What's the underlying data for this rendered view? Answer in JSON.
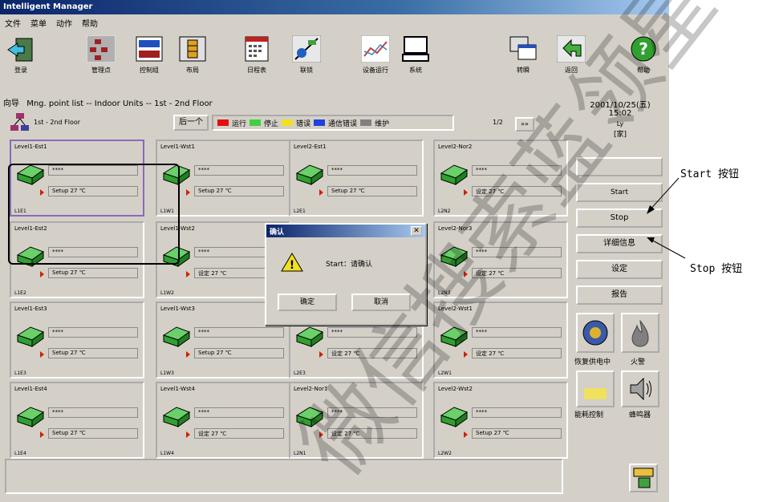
{
  "window": {
    "title": "Intelligent Manager"
  },
  "menu": [
    "文件",
    "菜单",
    "动作",
    "帮助"
  ],
  "toolbar": [
    "登录",
    "管理点",
    "控制组",
    "布局",
    "日程表",
    "联锁",
    "设备运行",
    "系统",
    "转瞬",
    "返回",
    "帮助"
  ],
  "nav": {
    "label": "向导",
    "path": "Mng. point list -- Indoor Units -- 1st - 2nd Floor"
  },
  "floor": {
    "name": "1st - 2nd Floor",
    "prev_label": "后一个",
    "page": "1/2",
    "next_label": "»»"
  },
  "legend": [
    {
      "label": "运行",
      "color": "#e01010"
    },
    {
      "label": "停止",
      "color": "#40d040"
    },
    {
      "label": "错误",
      "color": "#f0e020"
    },
    {
      "label": "通信错误",
      "color": "#2040e0"
    },
    {
      "label": "维护",
      "color": "#808080"
    }
  ],
  "units": [
    {
      "name": "Level1-Est1",
      "setpoint": "Setup 27 ℃",
      "code": "L1E1",
      "value": "****"
    },
    {
      "name": "Level1-Wst1",
      "setpoint": "Setup 27 ℃",
      "code": "L1W1",
      "value": "****"
    },
    {
      "name": "Level2-Est1",
      "setpoint": "Setup 27 ℃",
      "code": "L2E1",
      "value": "****"
    },
    {
      "name": "Level2-Nor2",
      "setpoint": "设定 27 ℃",
      "code": "L2N2",
      "value": "****"
    },
    {
      "name": "Level1-Est2",
      "setpoint": "Setup 27 ℃",
      "code": "L1E2",
      "value": "****"
    },
    {
      "name": "Level1-Wst2",
      "setpoint": "设定 27 ℃",
      "code": "L1W2",
      "value": "****"
    },
    {
      "name": "",
      "setpoint": "",
      "code": "",
      "value": ""
    },
    {
      "name": "Level2-Nor3",
      "setpoint": "设定 27 ℃",
      "code": "L2N3",
      "value": "****"
    },
    {
      "name": "Level1-Est3",
      "setpoint": "Setup 27 ℃",
      "code": "L1E3",
      "value": "****"
    },
    {
      "name": "Level1-Wst3",
      "setpoint": "Setup 27 ℃",
      "code": "L1W3",
      "value": "****"
    },
    {
      "name": "",
      "setpoint": "设定 27 ℃",
      "code": "L2E3",
      "value": "****"
    },
    {
      "name": "Level2-Wst1",
      "setpoint": "设定 27 ℃",
      "code": "L2W1",
      "value": "****"
    },
    {
      "name": "Level1-Est4",
      "setpoint": "Setup 27 ℃",
      "code": "L1E4",
      "value": "****"
    },
    {
      "name": "Level1-Wst4",
      "setpoint": "设定 27 ℃",
      "code": "L1W4",
      "value": "****"
    },
    {
      "name": "Level2-Nor1",
      "setpoint": "设定 27 ℃",
      "code": "L2N1",
      "value": "****"
    },
    {
      "name": "Level2-Wst2",
      "setpoint": "Setup 27 ℃",
      "code": "L2W2",
      "value": "****"
    }
  ],
  "right": {
    "date": "2001/10/25(五)",
    "time": "15:02",
    "user_label": "Ly",
    "user": "[家]",
    "buttons": [
      "Start",
      "Stop",
      "详细信息",
      "设定",
      "报告"
    ],
    "icons": [
      "恢复供电中",
      "火警",
      "能耗控制",
      "蜂鸣器"
    ]
  },
  "dialog": {
    "title": "确认",
    "message": "Start：请确认",
    "ok": "确定",
    "cancel": "取消"
  },
  "annotations": {
    "start": "Start 按钮",
    "stop": "Stop 按钮"
  },
  "watermark": "微信搜索蓝领星球"
}
